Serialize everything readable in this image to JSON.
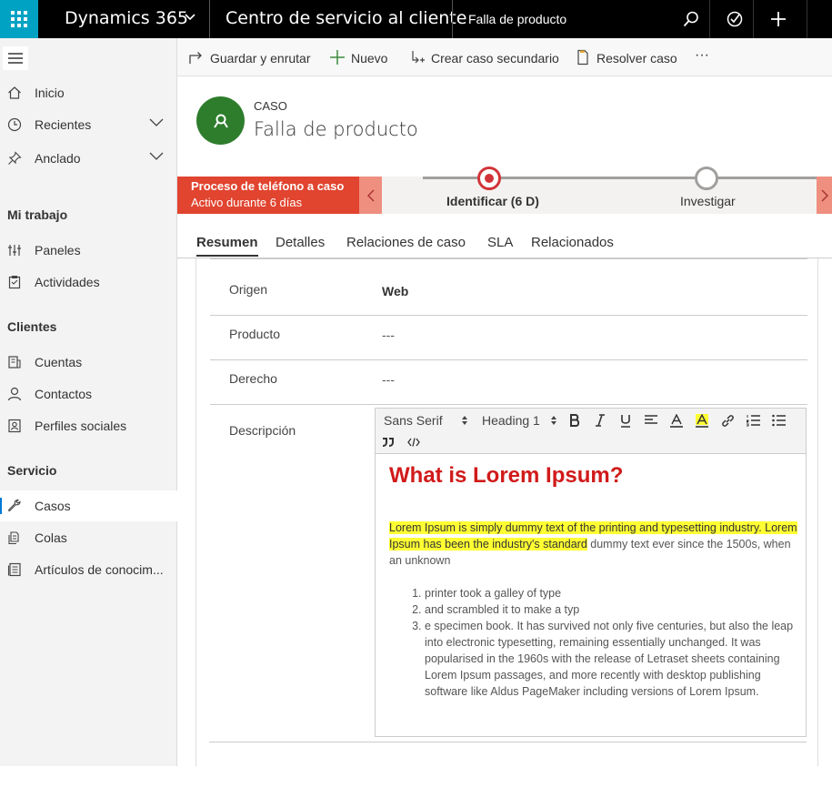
{
  "topbar": {
    "brand": "Dynamics 365",
    "app_name": "Centro de servicio al cliente",
    "page_name": "Falla de producto",
    "icons": [
      "search-icon",
      "assistant-icon",
      "add-icon"
    ]
  },
  "sidebar": {
    "items_top": [
      {
        "label": "Inicio",
        "icon": "home-icon"
      },
      {
        "label": "Recientes",
        "icon": "clock-icon"
      },
      {
        "label": "Anclado",
        "icon": "pin-icon"
      }
    ],
    "sections": [
      {
        "title": "Mi trabajo",
        "items": [
          {
            "label": "Paneles",
            "icon": "dashboard-icon"
          },
          {
            "label": "Actividades",
            "icon": "activities-icon"
          }
        ]
      },
      {
        "title": "Clientes",
        "items": [
          {
            "label": "Cuentas",
            "icon": "accounts-icon"
          },
          {
            "label": "Contactos",
            "icon": "contact-icon"
          },
          {
            "label": "Perfiles sociales",
            "icon": "social-profile-icon"
          }
        ]
      },
      {
        "title": "Servicio",
        "items": [
          {
            "label": "Casos",
            "icon": "wrench-icon"
          },
          {
            "label": "Colas",
            "icon": "queue-icon"
          },
          {
            "label": "Artículos de conocim...",
            "icon": "knowledge-icon"
          }
        ]
      }
    ]
  },
  "commands": {
    "save_route": "Guardar y enrutar",
    "new": "Nuevo",
    "child_case": "Crear caso secundario",
    "resolve": "Resolver caso",
    "more": "···"
  },
  "header": {
    "entity": "CASO",
    "title": "Falla de producto"
  },
  "bpf": {
    "name": "Proceso de teléfono a caso",
    "duration": "Activo durante 6 días",
    "stages": [
      {
        "label": "Identificar  (6 D)",
        "active": true
      },
      {
        "label": "Investigar",
        "active": false
      }
    ],
    "accent": "#e1442f"
  },
  "tabs": [
    "Resumen",
    "Detalles",
    "Relaciones de caso",
    "SLA",
    "Relacionados"
  ],
  "fields": [
    {
      "label": "Origen",
      "value": "Web"
    },
    {
      "label": "Producto",
      "value": "---"
    },
    {
      "label": "Derecho",
      "value": "---"
    },
    {
      "label": "Descripción",
      "value": ""
    }
  ],
  "editor": {
    "font": "Sans Serif",
    "heading": "Heading 1",
    "heading_text": "What is Lorem Ipsum?",
    "para_highlighted": "Lorem Ipsum is simply dummy text of the printing and typesetting industry. Lorem Ipsum has been the industry's standard",
    "para_rest": " dummy text ever since the 1500s, when an unknown",
    "list": [
      " printer took a galley of type",
      "and scrambled it to make a typ",
      "e specimen book. It has survived not only five centuries, but also the leap into electronic typesetting, remaining essentially unchanged. It was popularised in the 1960s with the release of Letraset sheets containing Lorem Ipsum passages, and more recently with desktop publishing software like Aldus PageMaker including versions of Lorem Ipsum."
    ],
    "heading_color": "#d11a1a",
    "highlight_color": "#ffff33"
  }
}
